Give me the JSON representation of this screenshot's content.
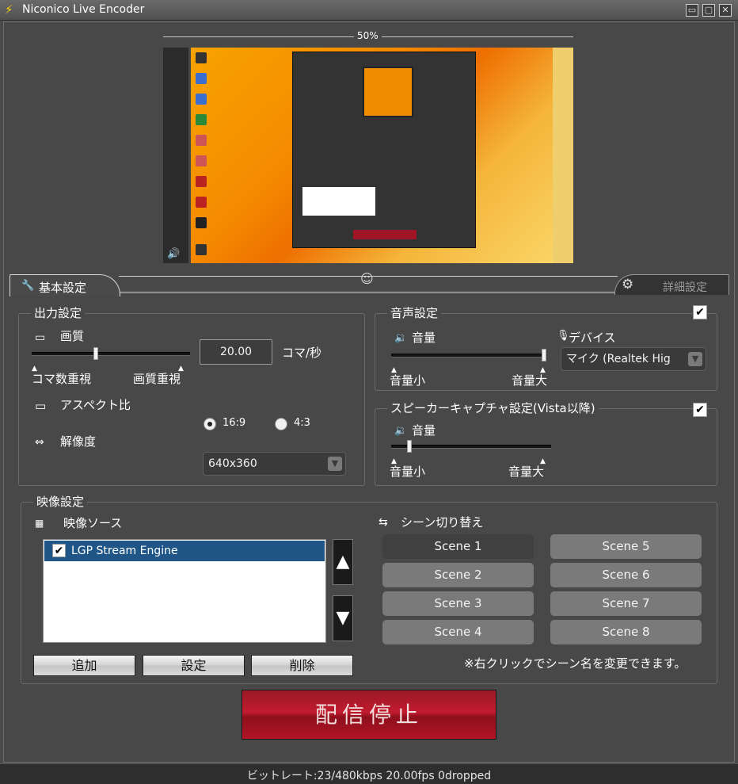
{
  "window": {
    "title": "Niconico Live Encoder",
    "controls": [
      "▭",
      "▢",
      "✕"
    ]
  },
  "preview": {
    "zoom_label": "50%"
  },
  "tabs": {
    "basic": "基本設定",
    "advanced": "詳細設定"
  },
  "output": {
    "title": "出力設定",
    "quality_label": "画質",
    "fps_value": "20.00",
    "fps_unit": "コマ/秒",
    "quality_slider_position": 0.4,
    "left_caption": "コマ数重視",
    "right_caption": "画質重視",
    "aspect_label": "アスペクト比",
    "aspect_options": [
      "16:9",
      "4:3"
    ],
    "aspect_selected": "16:9",
    "resolution_label": "解像度",
    "resolution_value": "640x360"
  },
  "audio": {
    "title": "音声設定",
    "enabled": true,
    "volume_label": "音量",
    "device_label": "デバイス",
    "device_value": "マイク (Realtek Hig",
    "volume_position": 1.0,
    "min_label": "音量小",
    "max_label": "音量大"
  },
  "speaker": {
    "title": "スピーカーキャプチャ設定(Vista以降)",
    "enabled": true,
    "volume_label": "音量",
    "volume_position": 0.1,
    "min_label": "音量小",
    "max_label": "音量大"
  },
  "video": {
    "title": "映像設定",
    "source_label": "映像ソース",
    "sources": [
      {
        "name": "LGP Stream Engine",
        "checked": true,
        "selected": true
      }
    ],
    "buttons": {
      "add": "追加",
      "settings": "設定",
      "delete": "削除"
    },
    "scene_label": "シーン切り替え",
    "scenes": [
      "Scene 1",
      "Scene 2",
      "Scene 3",
      "Scene 4",
      "Scene 5",
      "Scene 6",
      "Scene 7",
      "Scene 8"
    ],
    "active_scene": "Scene 1",
    "scene_hint": "※右クリックでシーン名を変更できます。"
  },
  "broadcast": {
    "stop_label": "配信停止"
  },
  "status": {
    "text": "ビットレート:23/480kbps 20.00fps 0dropped"
  }
}
